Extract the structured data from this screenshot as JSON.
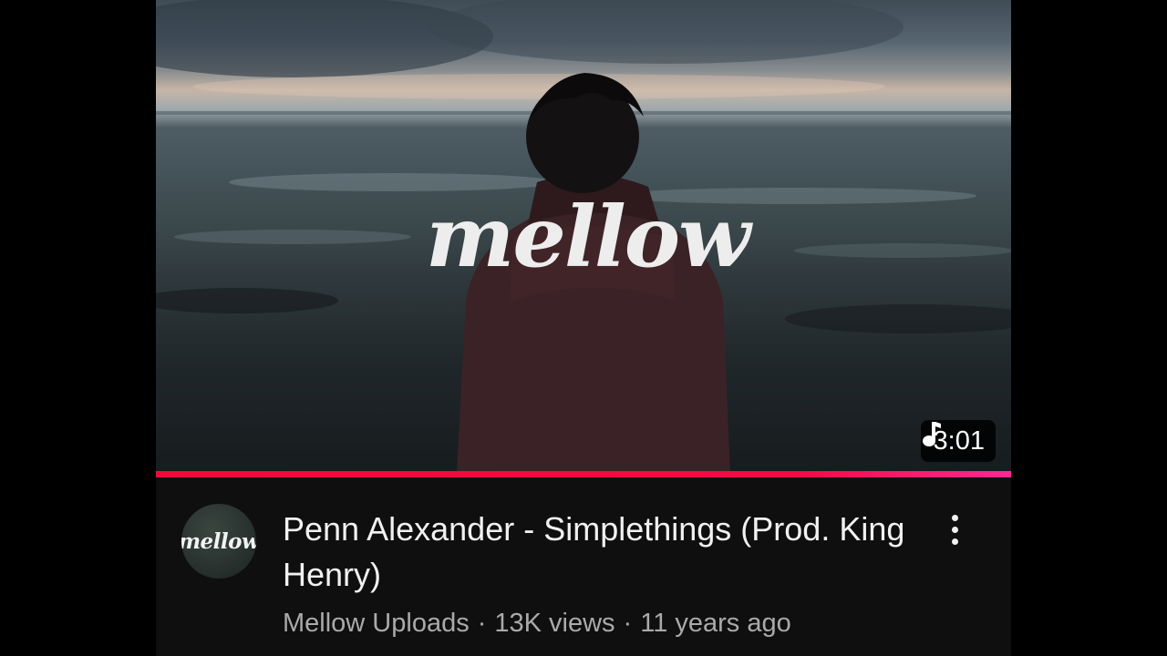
{
  "video": {
    "thumbnail_logo": "mellow",
    "duration": "3:01",
    "duration_icon": "music-note-icon",
    "progress": 1.0,
    "title": "Penn Alexander - Simplethings (Prod. King Henry)",
    "channel_name": "Mellow Uploads",
    "channel_avatar_text": "mellow",
    "views": "13K views",
    "age": "11 years ago",
    "separator": "·"
  },
  "menu": {
    "icon": "more-vert-icon"
  },
  "colors": {
    "background": "#0f0f0f",
    "progress": "#f00a39",
    "progress_end": "#ff2791",
    "title": "#f1f1f1",
    "meta": "#aaaaaa"
  }
}
